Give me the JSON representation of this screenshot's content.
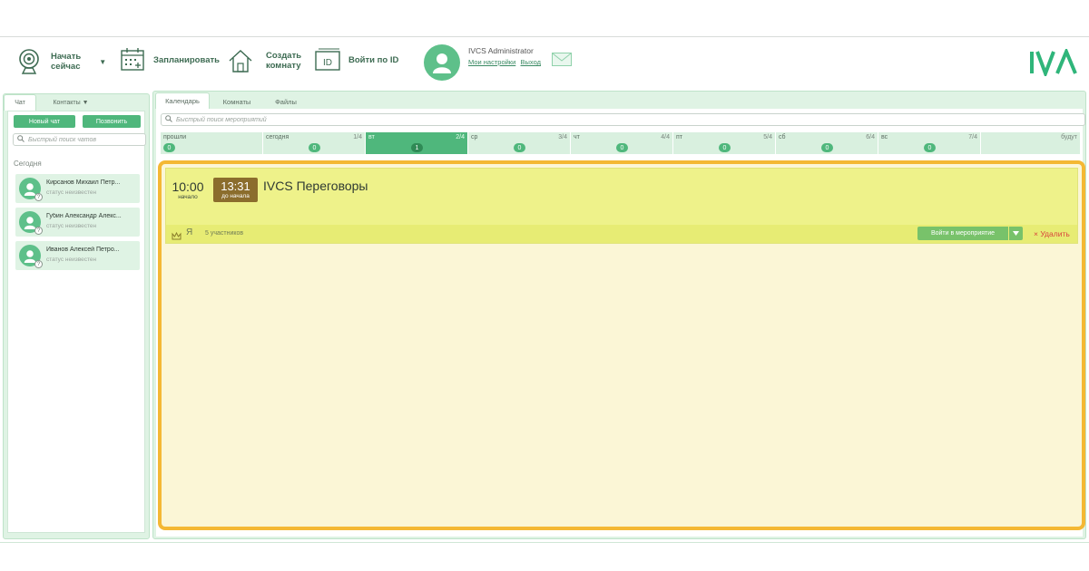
{
  "toolbar": {
    "start_now_line1": "Начать",
    "start_now_line2": "сейчас",
    "schedule": "Запланировать",
    "create_room_line1": "Создать",
    "create_room_line2": "комнату",
    "id_icon_text": "ID",
    "join_by_id": "Войти по ID"
  },
  "user": {
    "name": "IVCS Administrator",
    "settings_link": "Мои настройки",
    "logout_link": "Выход"
  },
  "logo": {
    "text": "IVA",
    "color": "#2fb57a"
  },
  "left": {
    "tabs": [
      "Чат",
      "Контакты ▼"
    ],
    "new_chat": "Новый чат",
    "call": "Позвонить",
    "search_placeholder": "Быстрый поиск чатов",
    "section": "Сегодня",
    "contacts": [
      {
        "name": "Кирсанов Михаил Петр...",
        "status": "статус неизвестен"
      },
      {
        "name": "Губин Александр Алекс...",
        "status": "статус неизвестен"
      },
      {
        "name": "Иванов Алексей Петро...",
        "status": "статус неизвестен"
      }
    ]
  },
  "main": {
    "tabs": [
      "Календарь",
      "Комнаты",
      "Файлы"
    ],
    "search_placeholder": "Быстрый поиск мероприятий",
    "days": [
      {
        "name": "прошли",
        "count": "",
        "badge": "0"
      },
      {
        "name": "сегодня",
        "count": "1/4",
        "badge": "0"
      },
      {
        "name": "вт",
        "count": "2/4",
        "badge": "1"
      },
      {
        "name": "ср",
        "count": "3/4",
        "badge": "0"
      },
      {
        "name": "чт",
        "count": "4/4",
        "badge": "0"
      },
      {
        "name": "пт",
        "count": "5/4",
        "badge": "0"
      },
      {
        "name": "сб",
        "count": "6/4",
        "badge": "0"
      },
      {
        "name": "вс",
        "count": "7/4",
        "badge": "0"
      },
      {
        "name": "",
        "count": "будут",
        "badge": ""
      }
    ]
  },
  "event": {
    "start_time": "10:00",
    "start_label": "начало",
    "countdown": "13:31",
    "countdown_label": "до начала",
    "title": "IVCS Переговоры",
    "organizer": "Я",
    "participants": "5 участников",
    "join_button": "Войти в мероприятие",
    "delete": "× Удалить"
  },
  "colors": {
    "accent": "#4fb77c",
    "highlight_frame": "#f4b834",
    "event_bg": "#eef28a",
    "countdown_bg": "#8b6d2d",
    "delete": "#d9443c"
  }
}
